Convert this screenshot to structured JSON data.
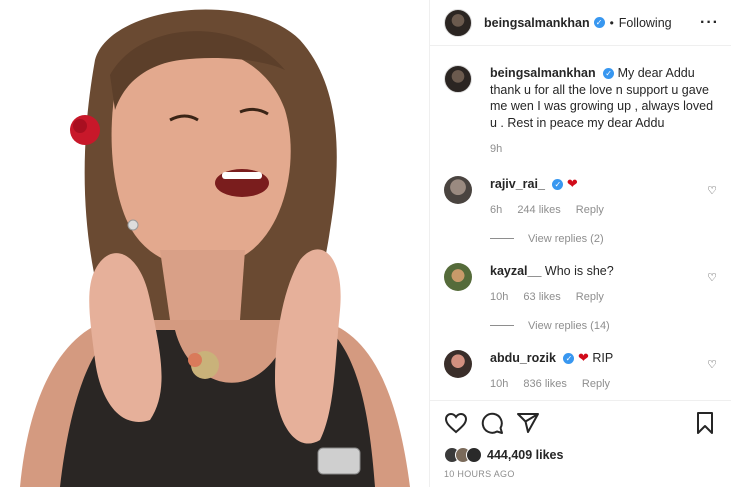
{
  "header": {
    "username": "beingsalmankhan",
    "follow_status": "Following",
    "more_icon": "more-icon"
  },
  "caption": {
    "username": "beingsalmankhan",
    "text": "My dear Addu thank u for all the love n support u gave me wen I was growing up , always loved u . Rest in peace my dear Addu",
    "time": "9h"
  },
  "comments": [
    {
      "username": "rajiv_rai_",
      "verified": true,
      "text": "",
      "emoji": "heart",
      "time": "6h",
      "likes": "244 likes",
      "reply": "Reply",
      "view_replies": "View replies (2)"
    },
    {
      "username": "kayzal__",
      "verified": false,
      "text": "Who is she?",
      "time": "10h",
      "likes": "63 likes",
      "reply": "Reply",
      "view_replies": "View replies (14)"
    },
    {
      "username": "abdu_rozik",
      "verified": true,
      "text": "RIP",
      "emoji": "heart",
      "time": "10h",
      "likes": "836 likes",
      "reply": "Reply"
    }
  ],
  "actions": {
    "likes": "444,409 likes",
    "timestamp": "10 HOURS AGO"
  },
  "colors": {
    "verified": "#3897f0",
    "heart_red": "#d10b1a",
    "muted": "#8e8e8e"
  }
}
